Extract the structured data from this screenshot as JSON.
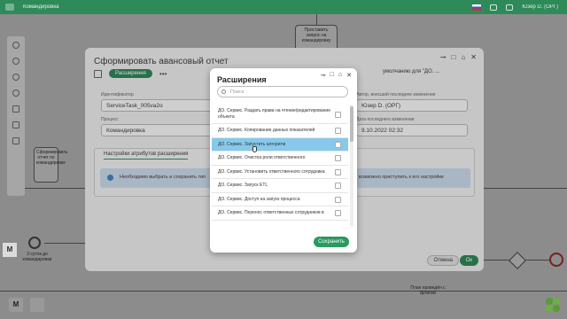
{
  "app": {
    "name": "Командировка",
    "user": "Юзер D. (ОРГ)"
  },
  "canvas": {
    "task_label": "Проставить запрос на командировку",
    "task_left_label": "Сформировать отчет по командировке",
    "timer_label": "3 суток до командировки",
    "bottom_left_label": "План проведён с флагом",
    "m_label": "M"
  },
  "dialog": {
    "title": "Сформировать авансовый отчет",
    "active_tab": "Расширения",
    "more": "•••",
    "selector_label": "умолчанию для \"ДО. ...",
    "id_label": "Идентификатор",
    "id_value": "ServiceTask_005va2o",
    "process_label": "Процесс",
    "process_value": "Командировка",
    "user_label": "Автор, внесший последнее изменение",
    "user_value": "Юзер D. (ОРГ)",
    "date_label": "Дата последнего изменения",
    "date_value": "9.10.2022 02:32",
    "section_title": "Настройки атрибутов расширения",
    "info_text": "Необходимо выбрать и сохранить тип",
    "info_right": "возможно приступить к его настройке",
    "cancel": "Отмена",
    "ok": "Ок"
  },
  "popup": {
    "title": "Расширения",
    "search_placeholder": "Поиск",
    "save": "Сохранить",
    "items": [
      {
        "label": "ДО. Сервис. Раздать права на чтение/редактирование объекта"
      },
      {
        "label": "ДО. Сервис. Копирование данных показателей"
      },
      {
        "label": "ДО. Сервис. Запустить алгоритм"
      },
      {
        "label": "ДО. Сервис. Очистка роли ответственного"
      },
      {
        "label": "ДО. Сервис. Установить ответственного сотрудника"
      },
      {
        "label": "ДО. Сервис. Запуск ETL"
      },
      {
        "label": "ДО. Сервис. Доступ на запуск процесса"
      },
      {
        "label": "ДО. Сервис. Перенос ответственных сотрудников в"
      }
    ],
    "selected_index": 2
  },
  "colors": {
    "accent": "#2a9a5e",
    "selected_row": "#88c8ea",
    "topbar": "#2f8a5a"
  }
}
